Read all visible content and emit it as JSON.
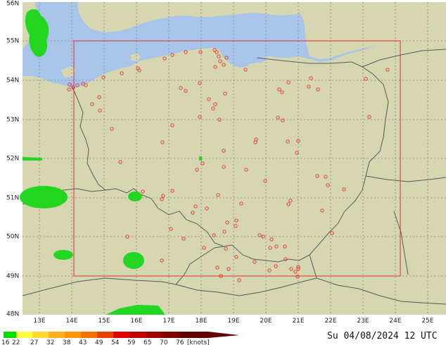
{
  "map": {
    "colors": {
      "land": "#d6d6b0",
      "sea": "#a8c4e8",
      "border": "#5a5a5a",
      "grid": "#888888",
      "region_box": "#e03030",
      "station": "#e03030",
      "wind_green": "#22d622"
    },
    "lat_labels": [
      "56N",
      "55N",
      "54N",
      "53N",
      "52N",
      "51N",
      "50N",
      "49N",
      "48N"
    ],
    "lon_labels": [
      "13E",
      "14E",
      "15E",
      "16E",
      "17E",
      "18E",
      "19E",
      "20E",
      "21E",
      "22E",
      "23E",
      "24E",
      "25E"
    ]
  },
  "legend": {
    "colors": [
      "#00e000",
      "#ffff40",
      "#ffd830",
      "#ffb020",
      "#ff9800",
      "#f07000",
      "#e84000",
      "#e00000",
      "#c00000",
      "#a00000",
      "#800000",
      "#600000"
    ],
    "ticks": [
      "16",
      "22",
      "27",
      "32",
      "38",
      "43",
      "49",
      "54",
      "59",
      "65",
      "70",
      "76"
    ],
    "unit": "[knots]"
  },
  "footer": {
    "datetime": "Su 04/08/2024 12 UTC"
  }
}
